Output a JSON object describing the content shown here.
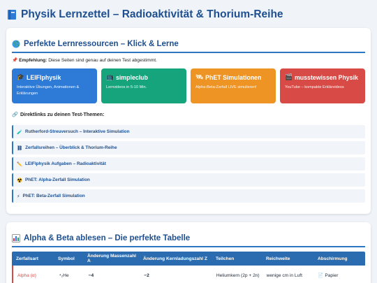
{
  "page": {
    "title": "Physik Lernzettel – Radioaktivität & Thorium-Reihe",
    "title_icon": "book-icon"
  },
  "resources": {
    "heading": "Perfekte Lernressourcen – Klick & Lerne",
    "heading_icon": "globe-icon",
    "recommend_label": "Empfehlung:",
    "recommend_text": "Diese Seiten sind genau auf deinen Test abgestimmt.",
    "tiles": [
      {
        "title": "LEIFIphysik",
        "icon": "graduation-cap-icon",
        "desc": "Interaktive Übungen, Animationen & Erklärungen",
        "color": "#2e7bd7"
      },
      {
        "title": "simpleclub",
        "icon": "tv-icon",
        "desc": "Lernvideos in 5-10 Min.",
        "color": "#16a47c"
      },
      {
        "title": "PhET Simulationen",
        "icon": "satellite-icon",
        "desc": "Alpha-Beta-Zerfall LIVE simulieren!",
        "color": "#ee9425"
      },
      {
        "title": "musstewissen Physik",
        "icon": "clapper-icon",
        "desc": "YouTube – kompakte Erklärvideos",
        "color": "#d84a45"
      }
    ],
    "links_heading": "Direktlinks zu deinen Test-Themen:",
    "links": [
      {
        "label": "Rutherford-Streuversuch – Interaktive Simulation",
        "icon": "test-tube-icon"
      },
      {
        "label": "Zerfallsreihen – Überblick & Thorium-Reihe",
        "icon": "chain-icon"
      },
      {
        "label": "LEIFIphysik Aufgaben – Radioaktivität",
        "icon": "pencil-icon"
      },
      {
        "label": "PhET: Alpha-Zerfall Simulation",
        "icon": "radioactive-icon"
      },
      {
        "label": "PhET: Beta-Zerfall Simulation",
        "icon": "lightning-icon"
      }
    ]
  },
  "table_section": {
    "heading": "Alpha & Beta ablesen – Die perfekte Tabelle",
    "heading_icon": "bar-chart-icon",
    "headers": [
      "Zerfallsart",
      "Symbol",
      "Änderung Massenzahl A",
      "Änderung Kernladungszahl Z",
      "Teilchen",
      "Reichweite",
      "Abschirmung"
    ],
    "rows": [
      {
        "type": "Alpha (α)",
        "symbol": "⁴₂He",
        "mass": "−4",
        "charge": "−2",
        "particle": "Heliumkern (2p + 2n)",
        "range": "wenige cm in Luft",
        "shield": "📄 Papier"
      }
    ]
  }
}
